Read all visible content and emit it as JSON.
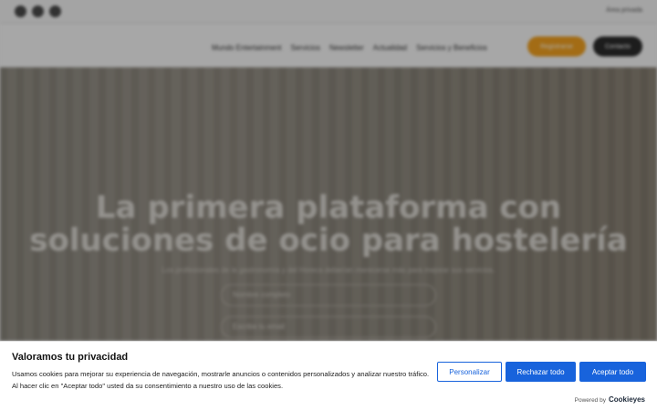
{
  "topbar": {
    "social_icons": [
      "facebook-icon",
      "instagram-icon",
      "linkedin-icon"
    ],
    "login_label": "Área privada"
  },
  "nav": {
    "items": [
      "Mundo Entertainment",
      "Servicios",
      "Newsletter",
      "Actualidad",
      "Servicios y Beneficios"
    ],
    "primary_button": "Registrarse",
    "secondary_button": "Contacto"
  },
  "hero": {
    "title": "La primera plataforma con soluciones de ocio para hostelería",
    "subtitle": "Los profesionales de la gastronomía y del Horeca deberían merecerse más para mejorar sus servicios.",
    "input1_placeholder": "Nombre completo",
    "input2_placeholder": "Escribe tu email"
  },
  "consent": {
    "title": "Valoramos tu privacidad",
    "text": "Usamos cookies para mejorar su experiencia de navegación, mostrarle anuncios o contenidos personalizados y analizar nuestro tráfico. Al hacer clic en \"Aceptar todo\" usted da su consentimiento a nuestro uso de las cookies.",
    "customize_label": "Personalizar",
    "reject_label": "Rechazar todo",
    "accept_label": "Aceptar todo",
    "powered_by": "Powered by",
    "brand": "Cookieyes",
    "accent_color": "#1863dc"
  }
}
